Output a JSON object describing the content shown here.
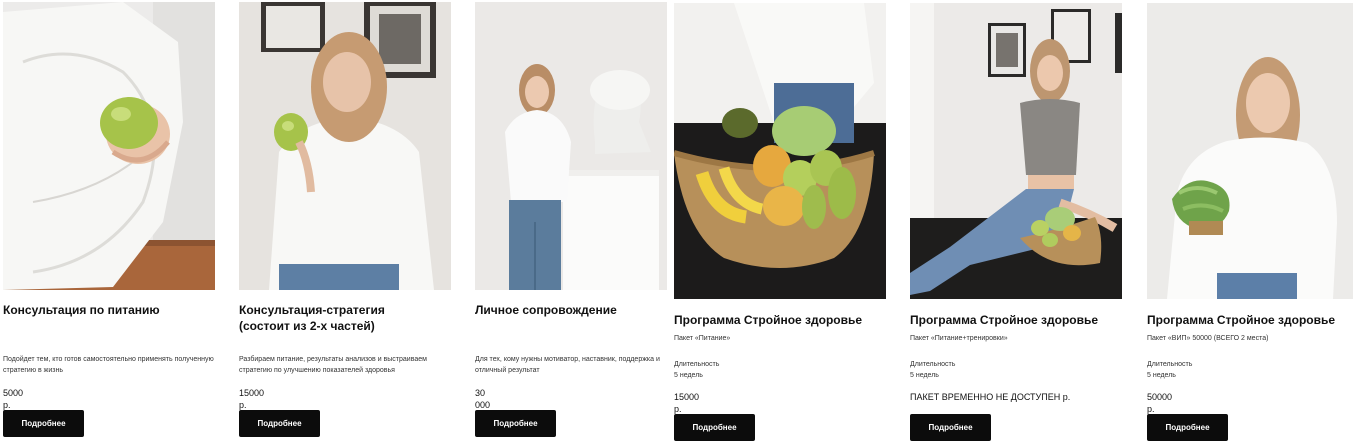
{
  "cards": [
    {
      "title": "Консультация по питанию",
      "description": "Подойдет тем, кто готов самостоятельно применять полученную стратегию в жизнь",
      "price": "5000 р.",
      "button": "Подробнее"
    },
    {
      "title": "Консультация-стратегия (состоит из 2-х частей)",
      "description": "Разбираем питание, результаты анализов и выстраиваем стратегию по улучшению показателей здоровья",
      "price": "15000 р.",
      "button": "Подробнее"
    },
    {
      "title": "Личное сопровождение",
      "description": "Для тех, кому нужны мотиватор, наставник, поддержка и отличный результат",
      "price": "30 000 р.",
      "button": "Подробнее"
    },
    {
      "title": "Программа Стройное здоровье",
      "description": "Пакет «Питание»",
      "duration": "Длительность 5 недель",
      "price": "15000 р.",
      "button": "Подробнее"
    },
    {
      "title": "Программа Стройное здоровье",
      "description": "Пакет «Питание+тренировки»",
      "duration": "Длительность 5 недель",
      "price": "ПАКЕТ ВРЕМЕННО НЕ ДОСТУПЕН р.",
      "button": "Подробнее"
    },
    {
      "title": "Программа Стройное здоровье",
      "description": "Пакет «ВИП» 50000 (ВСЕГО 2 места)",
      "duration": "Длительность 5 недель",
      "price": "50000 р.",
      "button": "Подробнее"
    }
  ]
}
